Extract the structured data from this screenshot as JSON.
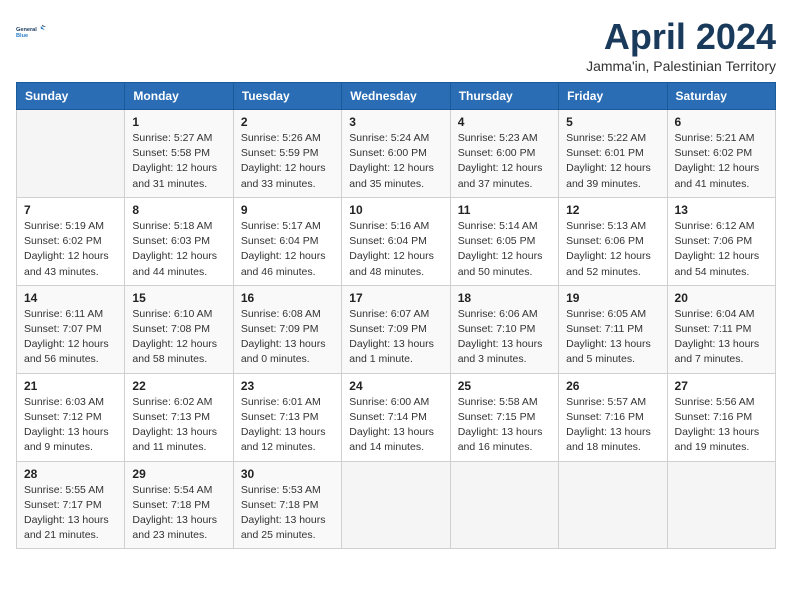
{
  "logo": {
    "line1": "General",
    "line2": "Blue"
  },
  "title": "April 2024",
  "subtitle": "Jamma'in, Palestinian Territory",
  "headers": [
    "Sunday",
    "Monday",
    "Tuesday",
    "Wednesday",
    "Thursday",
    "Friday",
    "Saturday"
  ],
  "weeks": [
    [
      {
        "day": "",
        "info": ""
      },
      {
        "day": "1",
        "info": "Sunrise: 5:27 AM\nSunset: 5:58 PM\nDaylight: 12 hours\nand 31 minutes."
      },
      {
        "day": "2",
        "info": "Sunrise: 5:26 AM\nSunset: 5:59 PM\nDaylight: 12 hours\nand 33 minutes."
      },
      {
        "day": "3",
        "info": "Sunrise: 5:24 AM\nSunset: 6:00 PM\nDaylight: 12 hours\nand 35 minutes."
      },
      {
        "day": "4",
        "info": "Sunrise: 5:23 AM\nSunset: 6:00 PM\nDaylight: 12 hours\nand 37 minutes."
      },
      {
        "day": "5",
        "info": "Sunrise: 5:22 AM\nSunset: 6:01 PM\nDaylight: 12 hours\nand 39 minutes."
      },
      {
        "day": "6",
        "info": "Sunrise: 5:21 AM\nSunset: 6:02 PM\nDaylight: 12 hours\nand 41 minutes."
      }
    ],
    [
      {
        "day": "7",
        "info": "Sunrise: 5:19 AM\nSunset: 6:02 PM\nDaylight: 12 hours\nand 43 minutes."
      },
      {
        "day": "8",
        "info": "Sunrise: 5:18 AM\nSunset: 6:03 PM\nDaylight: 12 hours\nand 44 minutes."
      },
      {
        "day": "9",
        "info": "Sunrise: 5:17 AM\nSunset: 6:04 PM\nDaylight: 12 hours\nand 46 minutes."
      },
      {
        "day": "10",
        "info": "Sunrise: 5:16 AM\nSunset: 6:04 PM\nDaylight: 12 hours\nand 48 minutes."
      },
      {
        "day": "11",
        "info": "Sunrise: 5:14 AM\nSunset: 6:05 PM\nDaylight: 12 hours\nand 50 minutes."
      },
      {
        "day": "12",
        "info": "Sunrise: 5:13 AM\nSunset: 6:06 PM\nDaylight: 12 hours\nand 52 minutes."
      },
      {
        "day": "13",
        "info": "Sunrise: 6:12 AM\nSunset: 7:06 PM\nDaylight: 12 hours\nand 54 minutes."
      }
    ],
    [
      {
        "day": "14",
        "info": "Sunrise: 6:11 AM\nSunset: 7:07 PM\nDaylight: 12 hours\nand 56 minutes."
      },
      {
        "day": "15",
        "info": "Sunrise: 6:10 AM\nSunset: 7:08 PM\nDaylight: 12 hours\nand 58 minutes."
      },
      {
        "day": "16",
        "info": "Sunrise: 6:08 AM\nSunset: 7:09 PM\nDaylight: 13 hours\nand 0 minutes."
      },
      {
        "day": "17",
        "info": "Sunrise: 6:07 AM\nSunset: 7:09 PM\nDaylight: 13 hours\nand 1 minute."
      },
      {
        "day": "18",
        "info": "Sunrise: 6:06 AM\nSunset: 7:10 PM\nDaylight: 13 hours\nand 3 minutes."
      },
      {
        "day": "19",
        "info": "Sunrise: 6:05 AM\nSunset: 7:11 PM\nDaylight: 13 hours\nand 5 minutes."
      },
      {
        "day": "20",
        "info": "Sunrise: 6:04 AM\nSunset: 7:11 PM\nDaylight: 13 hours\nand 7 minutes."
      }
    ],
    [
      {
        "day": "21",
        "info": "Sunrise: 6:03 AM\nSunset: 7:12 PM\nDaylight: 13 hours\nand 9 minutes."
      },
      {
        "day": "22",
        "info": "Sunrise: 6:02 AM\nSunset: 7:13 PM\nDaylight: 13 hours\nand 11 minutes."
      },
      {
        "day": "23",
        "info": "Sunrise: 6:01 AM\nSunset: 7:13 PM\nDaylight: 13 hours\nand 12 minutes."
      },
      {
        "day": "24",
        "info": "Sunrise: 6:00 AM\nSunset: 7:14 PM\nDaylight: 13 hours\nand 14 minutes."
      },
      {
        "day": "25",
        "info": "Sunrise: 5:58 AM\nSunset: 7:15 PM\nDaylight: 13 hours\nand 16 minutes."
      },
      {
        "day": "26",
        "info": "Sunrise: 5:57 AM\nSunset: 7:16 PM\nDaylight: 13 hours\nand 18 minutes."
      },
      {
        "day": "27",
        "info": "Sunrise: 5:56 AM\nSunset: 7:16 PM\nDaylight: 13 hours\nand 19 minutes."
      }
    ],
    [
      {
        "day": "28",
        "info": "Sunrise: 5:55 AM\nSunset: 7:17 PM\nDaylight: 13 hours\nand 21 minutes."
      },
      {
        "day": "29",
        "info": "Sunrise: 5:54 AM\nSunset: 7:18 PM\nDaylight: 13 hours\nand 23 minutes."
      },
      {
        "day": "30",
        "info": "Sunrise: 5:53 AM\nSunset: 7:18 PM\nDaylight: 13 hours\nand 25 minutes."
      },
      {
        "day": "",
        "info": ""
      },
      {
        "day": "",
        "info": ""
      },
      {
        "day": "",
        "info": ""
      },
      {
        "day": "",
        "info": ""
      }
    ]
  ]
}
